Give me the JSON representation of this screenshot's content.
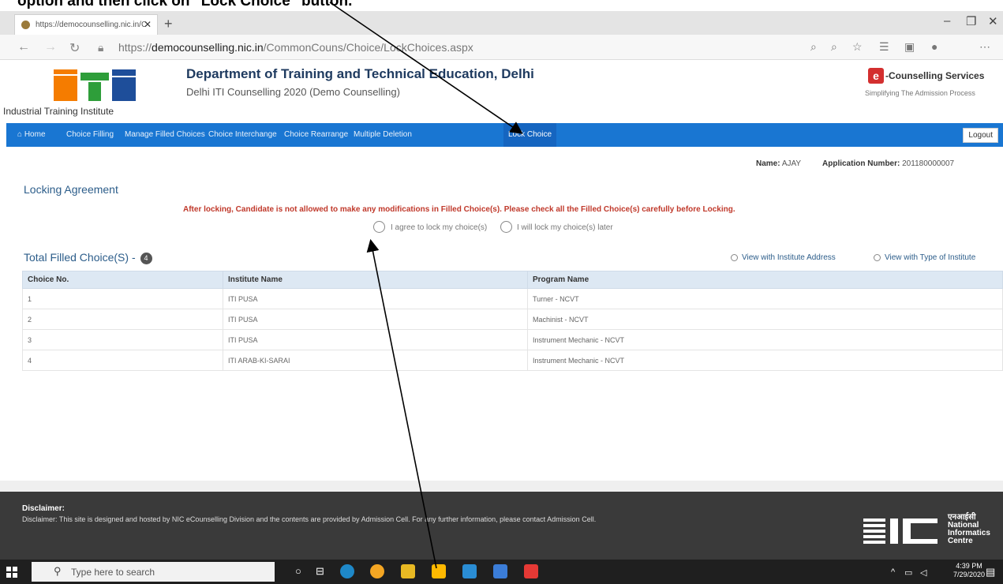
{
  "instruction_text": "option and then click on \"Lock Choice\" button.",
  "browser": {
    "tab_title": "https://democounselling.nic.in/C",
    "url_prefix": "https://",
    "url_domain": "democounselling.nic.in",
    "url_path": "/CommonCouns/Choice/LockChoices.aspx"
  },
  "header": {
    "iti_caption": "Industrial Training Institute",
    "title": "Department of Training and Technical Education, Delhi",
    "subtitle": "Delhi ITI Counselling 2020 (Demo Counselling)",
    "ec_logo_letter": "e",
    "ec_title": "-Counselling Services",
    "ec_subtitle": "Simplifying The Admission Process"
  },
  "nav": {
    "items": [
      "Home",
      "Choice Filling",
      "Manage Filled Choices",
      "Choice Interchange",
      "Choice Rearrange",
      "Multiple Deletion",
      "Lock Choice"
    ],
    "logout": "Logout"
  },
  "candidate": {
    "name_label": "Name:",
    "name": "AJAY",
    "app_label": "Application Number:",
    "app_number": "201180000007"
  },
  "locking": {
    "title": "Locking Agreement",
    "warning": "After locking, Candidate is not allowed to make any modifications in Filled Choice(s). Please check all the Filled Choice(s) carefully before Locking.",
    "option_agree": "I agree to lock my choice(s)",
    "option_later": "I will lock my choice(s) later"
  },
  "choices": {
    "title": "Total Filled Choice(S) -",
    "count": "4",
    "view_address": "View with Institute Address",
    "view_type": "View with Type of Institute",
    "columns": [
      "Choice No.",
      "Institute Name",
      "Program Name"
    ],
    "rows": [
      [
        "1",
        "ITI PUSA",
        "Turner - NCVT"
      ],
      [
        "2",
        "ITI PUSA",
        "Machinist - NCVT"
      ],
      [
        "3",
        "ITI PUSA",
        "Instrument Mechanic - NCVT"
      ],
      [
        "4",
        "ITI ARAB-KI-SARAI",
        "Instrument Mechanic - NCVT"
      ]
    ]
  },
  "footer": {
    "disclaimer_title": "Disclaimer:",
    "disclaimer_text": "Disclaimer: This site is designed and hosted by NIC eCounselling Division and the contents are provided by Admission Cell. For any further information, please contact Admission Cell.",
    "nic_hindi": "एनआईसी",
    "nic_line1": "National",
    "nic_line2": "Informatics",
    "nic_line3": "Centre"
  },
  "taskbar": {
    "search_placeholder": "Type here to search",
    "time": "4:39 PM",
    "date": "7/29/2020"
  },
  "colors": {
    "nav_blue": "#1976d2",
    "warning_red": "#c0392b",
    "title_blue": "#2c5d8a"
  }
}
